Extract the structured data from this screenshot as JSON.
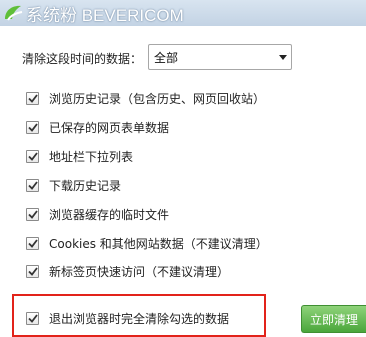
{
  "watermark": {
    "text": "系统粉 BEVERICOM"
  },
  "range": {
    "label": "清除这段时间的数据：",
    "selected": "全部"
  },
  "options": [
    {
      "label": "浏览历史记录（包含历史、网页回收站）",
      "checked": true
    },
    {
      "label": "已保存的网页表单数据",
      "checked": true
    },
    {
      "label": "地址栏下拉列表",
      "checked": true
    },
    {
      "label": "下载历史记录",
      "checked": true
    },
    {
      "label": "浏览器缓存的临时文件",
      "checked": true
    },
    {
      "label": "Cookies 和其他网站数据（不建议清理）",
      "checked": true
    },
    {
      "label": "新标签页快速访问（不建议清理）",
      "checked": true
    }
  ],
  "exit_option": {
    "label": "退出浏览器时完全清除勾选的数据",
    "checked": true
  },
  "buttons": {
    "clear_now": "立即清理"
  },
  "colors": {
    "highlight": "#e2231a",
    "button": "#4aa63b",
    "check": "#333333"
  }
}
